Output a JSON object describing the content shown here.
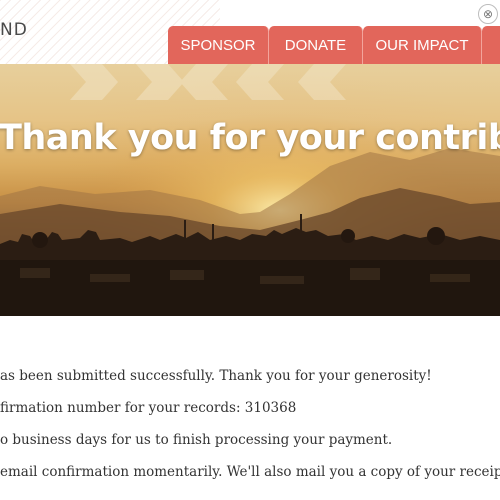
{
  "header": {
    "logo_text": "ND",
    "close_glyph": "⊗"
  },
  "nav": {
    "items": [
      {
        "label": "SPONSOR"
      },
      {
        "label": "DONATE"
      },
      {
        "label": "OUR IMPACT"
      },
      {
        "label": ""
      }
    ]
  },
  "hero": {
    "title": "Thank you for your contribution"
  },
  "content": {
    "lines": [
      "as been submitted successfully. Thank you for your generosity!",
      "firmation number for your records: 310368",
      "o business days for us to finish processing your payment.",
      "email confirmation momentarily. We'll also mail you a copy of your receipt."
    ]
  },
  "colors": {
    "nav_accent": "#e2665b",
    "body_text": "#333333"
  },
  "icons": {
    "close": "close-icon"
  }
}
